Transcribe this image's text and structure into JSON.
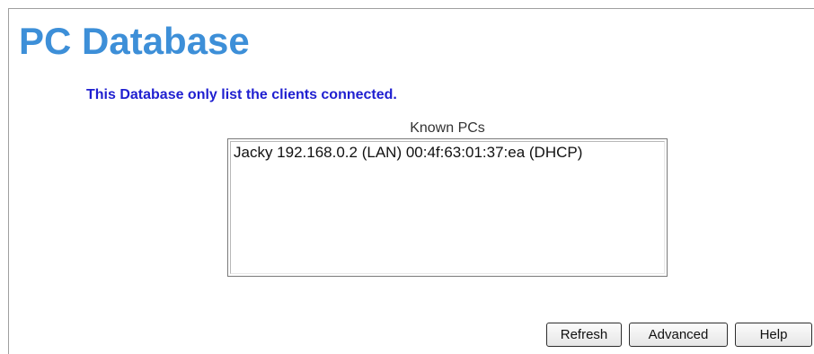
{
  "page": {
    "title": "PC Database",
    "notice": "This Database only list the clients connected."
  },
  "known_pcs": {
    "label": "Known PCs",
    "items": [
      "Jacky 192.168.0.2 (LAN) 00:4f:63:01:37:ea (DHCP)"
    ]
  },
  "buttons": {
    "refresh": "Refresh",
    "advanced": "Advanced",
    "help": "Help"
  },
  "colors": {
    "title": "#3d8fd8",
    "notice": "#1f1fd0"
  }
}
